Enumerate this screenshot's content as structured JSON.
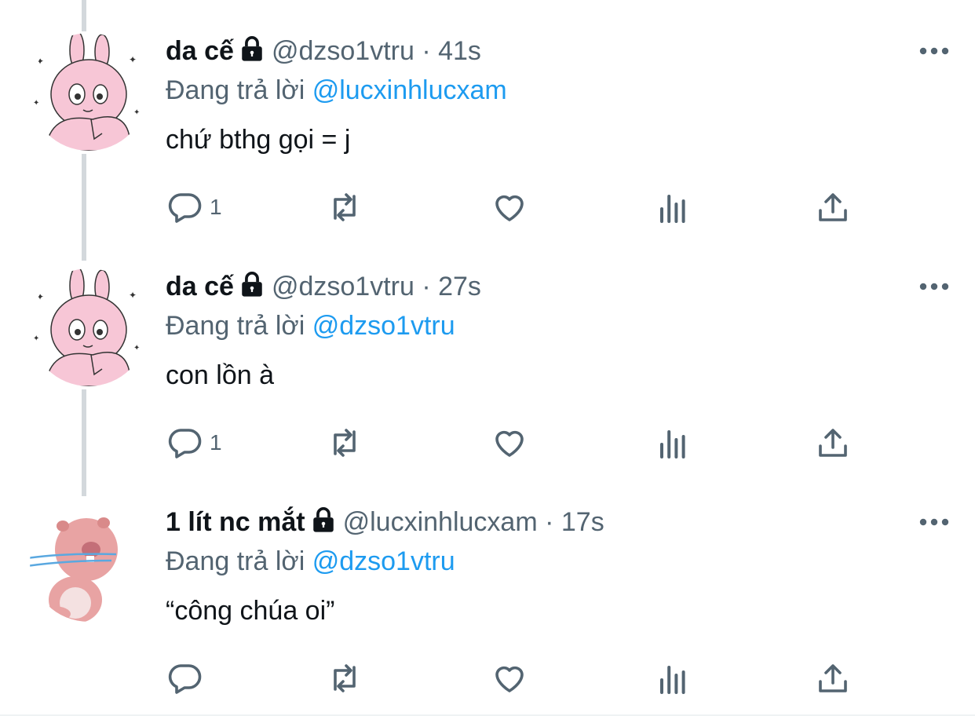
{
  "tweets": [
    {
      "display_name": "da cế",
      "handle": "@dzso1vtru",
      "time": "· 41s",
      "reply_prefix": "Đang trả lời ",
      "reply_to": "@lucxinhlucxam",
      "text": "chứ bthg gọi = j",
      "reply_count": "1",
      "avatar": "bunny-avatar"
    },
    {
      "display_name": "da cế",
      "handle": "@dzso1vtru",
      "time": "· 27s",
      "reply_prefix": "Đang trả lời ",
      "reply_to": "@dzso1vtru",
      "text": "con lồn à",
      "reply_count": "1",
      "avatar": "bunny-avatar"
    },
    {
      "display_name": "1 lít nc mắt",
      "handle": "@lucxinhlucxam",
      "time": "· 17s",
      "reply_prefix": "Đang trả lời ",
      "reply_to": "@dzso1vtru",
      "text": "“công chúa oi”",
      "reply_count": "",
      "avatar": "beaver-avatar"
    }
  ],
  "colors": {
    "text": "#0f1419",
    "secondary": "#536471",
    "link": "#1d9bf0",
    "thread_line": "#d3d8dc",
    "avatar_pink": "#f7c6d6"
  },
  "icons": [
    "lock-icon",
    "more-icon",
    "reply-icon",
    "retweet-icon",
    "like-icon",
    "views-icon",
    "share-icon"
  ]
}
